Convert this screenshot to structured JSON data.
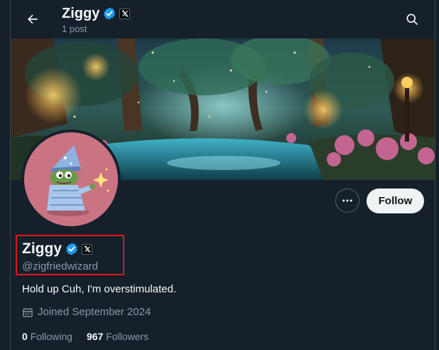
{
  "header": {
    "name": "Ziggy",
    "post_count": "1 post"
  },
  "profile": {
    "display_name": "Ziggy",
    "handle": "@zigfriedwizard",
    "bio": "Hold up Cuh, I'm overstimulated.",
    "joined": "Joined September 2024",
    "following_count": "0",
    "following_label": "Following",
    "followers_count": "967",
    "followers_label": "Followers"
  },
  "actions": {
    "follow_label": "Follow"
  },
  "icons": {
    "back": "arrow-left-icon",
    "search": "search-icon",
    "verified": "verified-badge-icon",
    "affiliate": "x-affiliate-icon",
    "more": "more-options-icon",
    "calendar": "calendar-icon"
  },
  "colors": {
    "background": "#15202b",
    "verified_blue": "#1d9bf0",
    "muted_text": "#8b98a5",
    "highlight_red": "#e0161c"
  }
}
